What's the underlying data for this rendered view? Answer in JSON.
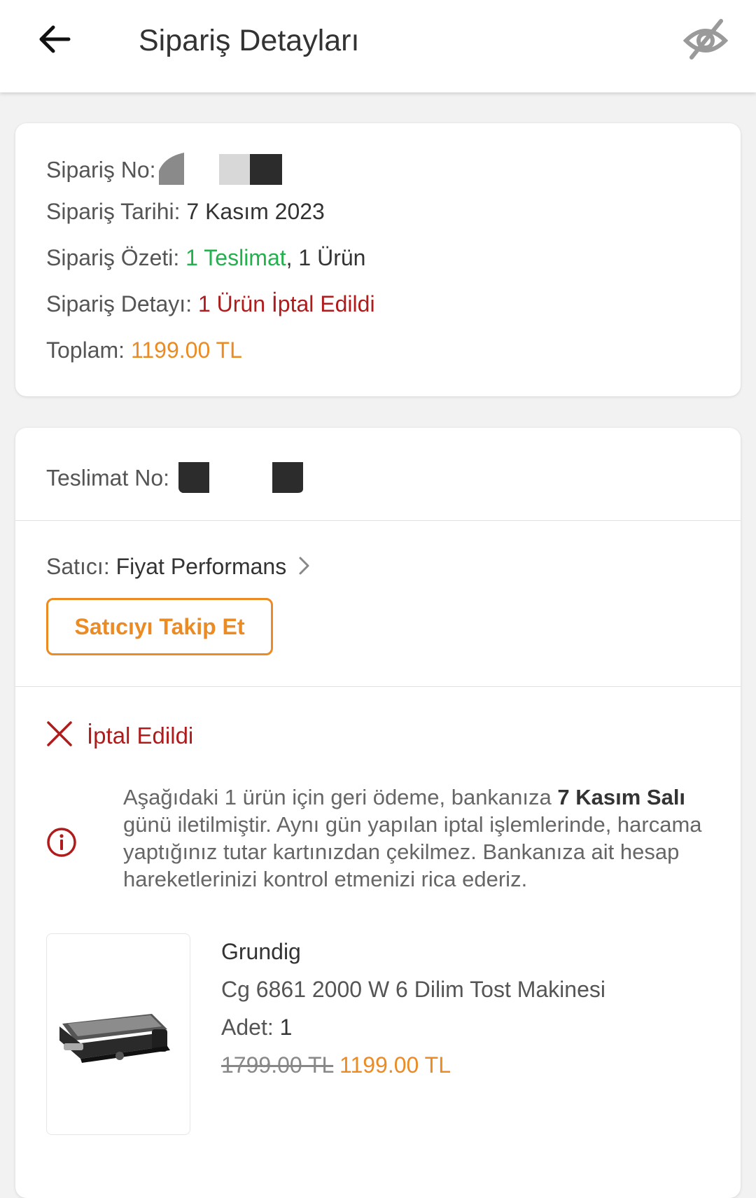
{
  "header": {
    "title": "Sipariş Detayları"
  },
  "order": {
    "no_label": "Sipariş No:",
    "date_label": "Sipariş Tarihi:",
    "date_value": "7 Kasım 2023",
    "summary_label": "Sipariş Özeti:",
    "summary_green": "1 Teslimat",
    "summary_rest": ", 1 Ürün",
    "detail_label": "Sipariş Detayı:",
    "detail_value": "1 Ürün İptal Edildi",
    "total_label": "Toplam:",
    "total_value": "1199.00 TL"
  },
  "delivery": {
    "no_label": "Teslimat No:",
    "seller_label": "Satıcı:",
    "seller_name": "Fiyat Performans",
    "follow_button": "Satıcıyı Takip Et",
    "status": "İptal Edildi",
    "notice": {
      "part1": "Aşağıdaki 1 ürün için geri ödeme, bankanıza ",
      "bold": "7 Kasım Salı",
      "part2": " günü iletilmiştir. Aynı gün yapılan iptal işlemlerinde, harcama yaptığınız tutar kartınızdan çekilmez. Bankanıza ait hesap hareketlerinizi kontrol etmenizi rica ederiz."
    }
  },
  "product": {
    "brand": "Grundig",
    "name": "Cg 6861 2000 W 6 Dilim Tost Makinesi",
    "quantity_label": "Adet:",
    "quantity": "1",
    "old_price": "1799.00 TL",
    "price": "1199.00 TL"
  },
  "colors": {
    "orange": "#ec8b23",
    "green": "#22b14c",
    "red": "#b01c1c"
  }
}
